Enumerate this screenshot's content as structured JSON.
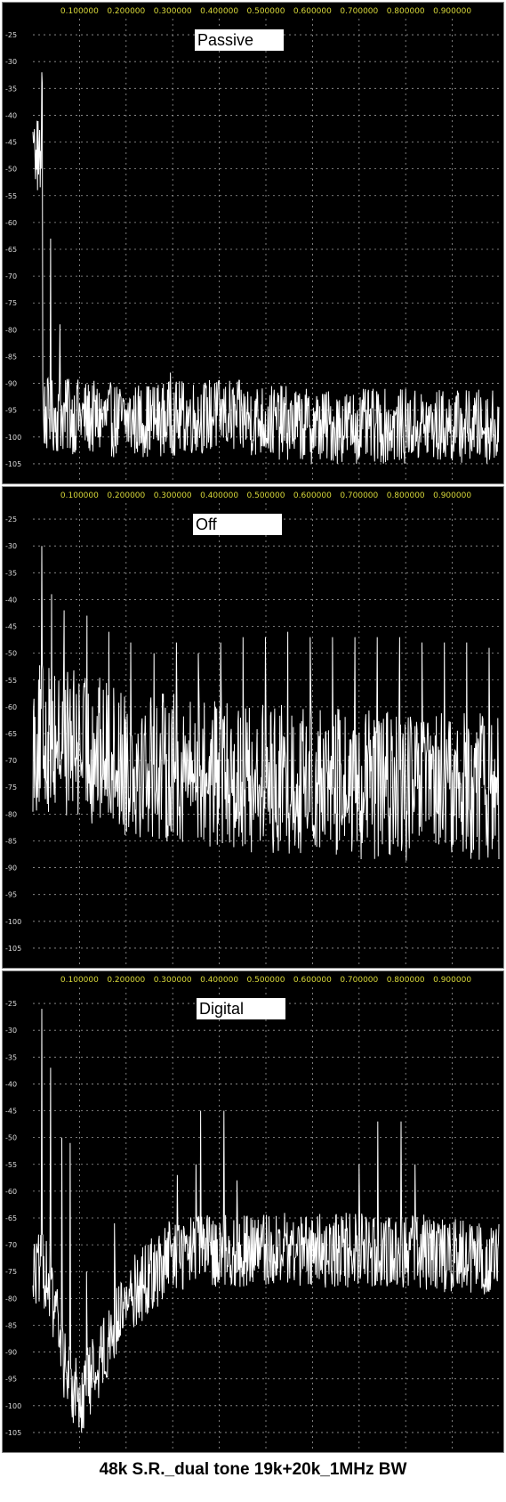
{
  "caption": "48k S.R._dual tone 19k+20k_1MHz BW",
  "colors": {
    "background": "#000000",
    "grid": "#9a9a9a",
    "trace": "#ffffff",
    "x_tick": "#d8d83a",
    "y_tick": "#dcdcdc",
    "label_box": "#ffffff"
  },
  "chart_data": [
    {
      "type": "line",
      "title": "Passive",
      "xlim": [
        0,
        1.0
      ],
      "ylim": [
        -108,
        -22
      ],
      "x_ticks": [
        "0.100000",
        "0.200000",
        "0.300000",
        "0.400000",
        "0.500000",
        "0.600000",
        "0.700000",
        "0.800000",
        "0.900000"
      ],
      "y_ticks": [
        "-25",
        "-30",
        "-35",
        "-40",
        "-45",
        "-50",
        "-55",
        "-60",
        "-65",
        "-70",
        "-75",
        "-80",
        "-85",
        "-90",
        "-95",
        "-100",
        "-105"
      ],
      "grid": true,
      "peaks": [
        {
          "x": 0.019,
          "y": -32
        },
        {
          "x": 0.02,
          "y": -34
        },
        {
          "x": 0.038,
          "y": -63
        },
        {
          "x": 0.058,
          "y": -79
        },
        {
          "x": 0.075,
          "y": -90
        },
        {
          "x": 0.095,
          "y": -91
        },
        {
          "x": 0.295,
          "y": -88
        },
        {
          "x": 0.39,
          "y": -90
        },
        {
          "x": 0.41,
          "y": -91
        }
      ],
      "noise_floor": [
        {
          "x": 0.05,
          "y": -96
        },
        {
          "x": 0.2,
          "y": -97
        },
        {
          "x": 0.4,
          "y": -96
        },
        {
          "x": 0.6,
          "y": -98
        },
        {
          "x": 0.8,
          "y": -98
        },
        {
          "x": 1.0,
          "y": -98
        }
      ]
    },
    {
      "type": "line",
      "title": "Off",
      "xlim": [
        0,
        1.0
      ],
      "ylim": [
        -108,
        -22
      ],
      "x_ticks": [
        "0.100000",
        "0.200000",
        "0.300000",
        "0.400000",
        "0.500000",
        "0.600000",
        "0.700000",
        "0.800000",
        "0.900000"
      ],
      "y_ticks": [
        "-25",
        "-30",
        "-35",
        "-40",
        "-45",
        "-50",
        "-55",
        "-60",
        "-65",
        "-70",
        "-75",
        "-80",
        "-85",
        "-90",
        "-95",
        "-100",
        "-105"
      ],
      "grid": true,
      "peaks": [
        {
          "x": 0.019,
          "y": -30
        },
        {
          "x": 0.04,
          "y": -39
        },
        {
          "x": 0.067,
          "y": -42
        },
        {
          "x": 0.116,
          "y": -43
        },
        {
          "x": 0.163,
          "y": -46
        },
        {
          "x": 0.21,
          "y": -48
        },
        {
          "x": 0.26,
          "y": -50
        },
        {
          "x": 0.308,
          "y": -48
        },
        {
          "x": 0.355,
          "y": -50
        },
        {
          "x": 0.403,
          "y": -48
        },
        {
          "x": 0.451,
          "y": -47
        },
        {
          "x": 0.499,
          "y": -47
        },
        {
          "x": 0.547,
          "y": -46
        },
        {
          "x": 0.595,
          "y": -47
        },
        {
          "x": 0.643,
          "y": -47
        },
        {
          "x": 0.691,
          "y": -47
        },
        {
          "x": 0.739,
          "y": -47
        },
        {
          "x": 0.787,
          "y": -47
        },
        {
          "x": 0.835,
          "y": -48
        },
        {
          "x": 0.883,
          "y": -48
        },
        {
          "x": 0.931,
          "y": -48
        },
        {
          "x": 0.979,
          "y": -49
        }
      ],
      "noise_floor": [
        {
          "x": 0.05,
          "y": -66
        },
        {
          "x": 0.2,
          "y": -70
        },
        {
          "x": 0.4,
          "y": -73
        },
        {
          "x": 0.6,
          "y": -74
        },
        {
          "x": 0.8,
          "y": -75
        },
        {
          "x": 1.0,
          "y": -75
        }
      ]
    },
    {
      "type": "line",
      "title": "Digital",
      "xlim": [
        0,
        1.0
      ],
      "ylim": [
        -108,
        -22
      ],
      "x_ticks": [
        "0.100000",
        "0.200000",
        "0.300000",
        "0.400000",
        "0.500000",
        "0.600000",
        "0.700000",
        "0.800000",
        "0.900000"
      ],
      "y_ticks": [
        "-25",
        "-30",
        "-35",
        "-40",
        "-45",
        "-50",
        "-55",
        "-60",
        "-65",
        "-70",
        "-75",
        "-80",
        "-85",
        "-90",
        "-95",
        "-100",
        "-105"
      ],
      "grid": true,
      "peaks": [
        {
          "x": 0.019,
          "y": -26
        },
        {
          "x": 0.038,
          "y": -37
        },
        {
          "x": 0.062,
          "y": -50
        },
        {
          "x": 0.08,
          "y": -51
        },
        {
          "x": 0.115,
          "y": -75
        },
        {
          "x": 0.175,
          "y": -66
        },
        {
          "x": 0.31,
          "y": -57
        },
        {
          "x": 0.35,
          "y": -55
        },
        {
          "x": 0.36,
          "y": -45
        },
        {
          "x": 0.41,
          "y": -45
        },
        {
          "x": 0.438,
          "y": -58
        },
        {
          "x": 0.7,
          "y": -55
        },
        {
          "x": 0.74,
          "y": -47
        },
        {
          "x": 0.79,
          "y": -47
        },
        {
          "x": 0.82,
          "y": -55
        }
      ],
      "noise_floor": [
        {
          "x": 0.03,
          "y": -75
        },
        {
          "x": 0.07,
          "y": -93
        },
        {
          "x": 0.1,
          "y": -99
        },
        {
          "x": 0.15,
          "y": -90
        },
        {
          "x": 0.2,
          "y": -80
        },
        {
          "x": 0.3,
          "y": -72
        },
        {
          "x": 0.4,
          "y": -71
        },
        {
          "x": 0.6,
          "y": -71
        },
        {
          "x": 0.8,
          "y": -71
        },
        {
          "x": 1.0,
          "y": -73
        }
      ]
    }
  ]
}
